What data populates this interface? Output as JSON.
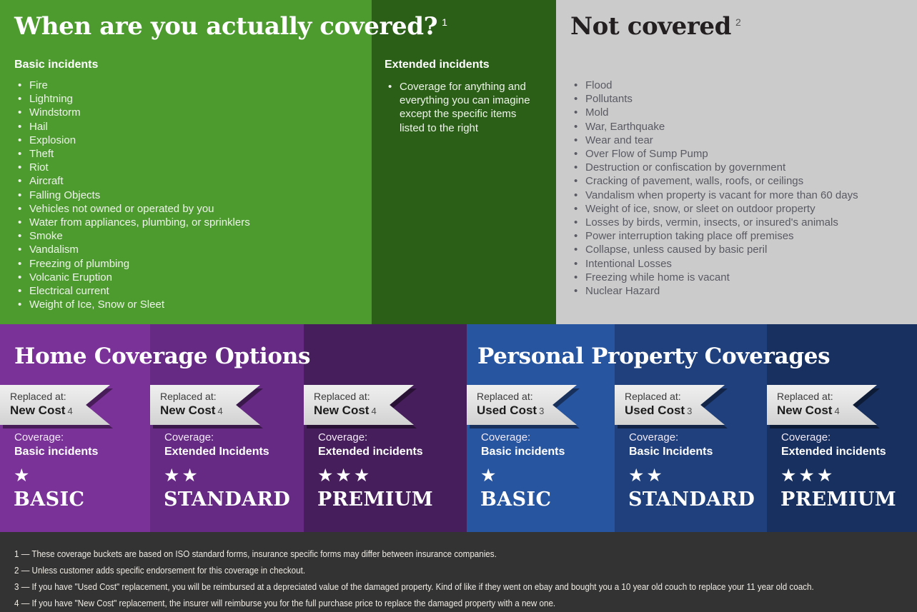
{
  "covered": {
    "title": "When are you actually covered?",
    "title_superscript": "1",
    "basic_heading": "Basic incidents",
    "basic_items": [
      "Fire",
      "Lightning",
      "Windstorm",
      "Hail",
      "Explosion",
      "Theft",
      "Riot",
      "Aircraft",
      "Falling Objects",
      "Vehicles not owned or operated by you",
      "Water from appliances, plumbing, or sprinklers",
      "Smoke",
      "Vandalism",
      "Freezing of plumbing",
      "Volcanic Eruption",
      "Electrical current",
      "Weight of Ice, Snow or Sleet"
    ],
    "extended_heading": "Extended incidents",
    "extended_items": [
      "Coverage for anything and everything you can imagine except the specific items listed to the right"
    ]
  },
  "not_covered": {
    "title": "Not covered",
    "title_superscript": "2",
    "items": [
      "Flood",
      "Pollutants",
      "Mold",
      "War, Earthquake",
      "Wear and tear",
      "Over Flow of Sump Pump",
      "Destruction or confiscation by government",
      "Cracking of pavement, walls, roofs, or ceilings",
      "Vandalism when property is vacant for more than 60 days",
      "Weight of ice, snow, or sleet on outdoor property",
      "Losses by birds, vermin, insects, or insured's animals",
      "Power interruption taking place off premises",
      "Collapse, unless caused by basic peril",
      "Intentional Losses",
      "Freezing while home is vacant",
      "Nuclear Hazard"
    ]
  },
  "home_coverage": {
    "title": "Home Coverage Options",
    "columns": [
      {
        "replaced_label": "Replaced at:",
        "replaced_value": "New Cost",
        "replaced_note": "4",
        "coverage_label": "Coverage:",
        "coverage_value": "Basic incidents",
        "stars": "★",
        "star_count": 1,
        "tier": "BASIC",
        "color": "#7a3198"
      },
      {
        "replaced_label": "Replaced at:",
        "replaced_value": "New Cost",
        "replaced_note": "4",
        "coverage_label": "Coverage:",
        "coverage_value": "Extended Incidents",
        "stars": "★★",
        "star_count": 2,
        "tier": "STANDARD",
        "color": "#662a84"
      },
      {
        "replaced_label": "Replaced at:",
        "replaced_value": "New Cost",
        "replaced_note": "4",
        "coverage_label": "Coverage:",
        "coverage_value": "Extended incidents",
        "stars": "★★★",
        "star_count": 3,
        "tier": "PREMIUM",
        "color": "#471e5c"
      }
    ]
  },
  "personal_property": {
    "title": "Personal Property Coverages",
    "columns": [
      {
        "replaced_label": "Replaced at:",
        "replaced_value": "Used Cost",
        "replaced_note": "3",
        "coverage_label": "Coverage:",
        "coverage_value": "Basic incidents",
        "stars": "★",
        "star_count": 1,
        "tier": "BASIC",
        "color": "#28559f"
      },
      {
        "replaced_label": "Replaced at:",
        "replaced_value": "Used Cost",
        "replaced_note": "3",
        "coverage_label": "Coverage:",
        "coverage_value": "Basic Incidents",
        "stars": "★★",
        "star_count": 2,
        "tier": "STANDARD",
        "color": "#1f407c"
      },
      {
        "replaced_label": "Replaced at:",
        "replaced_value": "New Cost",
        "replaced_note": "4",
        "coverage_label": "Coverage:",
        "coverage_value": "Extended incidents",
        "stars": "★★★",
        "star_count": 3,
        "tier": "PREMIUM",
        "color": "#17305f"
      }
    ]
  },
  "footnotes": [
    "1 — These coverage buckets are based on ISO standard forms, insurance specific forms may differ between insurance companies.",
    "2 — Unless customer adds specific endorsement for this coverage in checkout.",
    "3 — If you have \"Used Cost\" replacement, you will be reimbursed at a depreciated value of the damaged property. Kind of like if they went on ebay and bought you a 10 year old couch to replace your 11 year old coach.",
    "4 — If you have \"New Cost\" replacement, the insurer will reimburse you for the full purchase price to replace the damaged property with a new one."
  ],
  "colors": {
    "green_light": "#4d9b2f",
    "green_dark": "#2b5f17",
    "gray_panel": "#cbcbcb",
    "footer": "#333333"
  },
  "bullet_glyph": "•"
}
